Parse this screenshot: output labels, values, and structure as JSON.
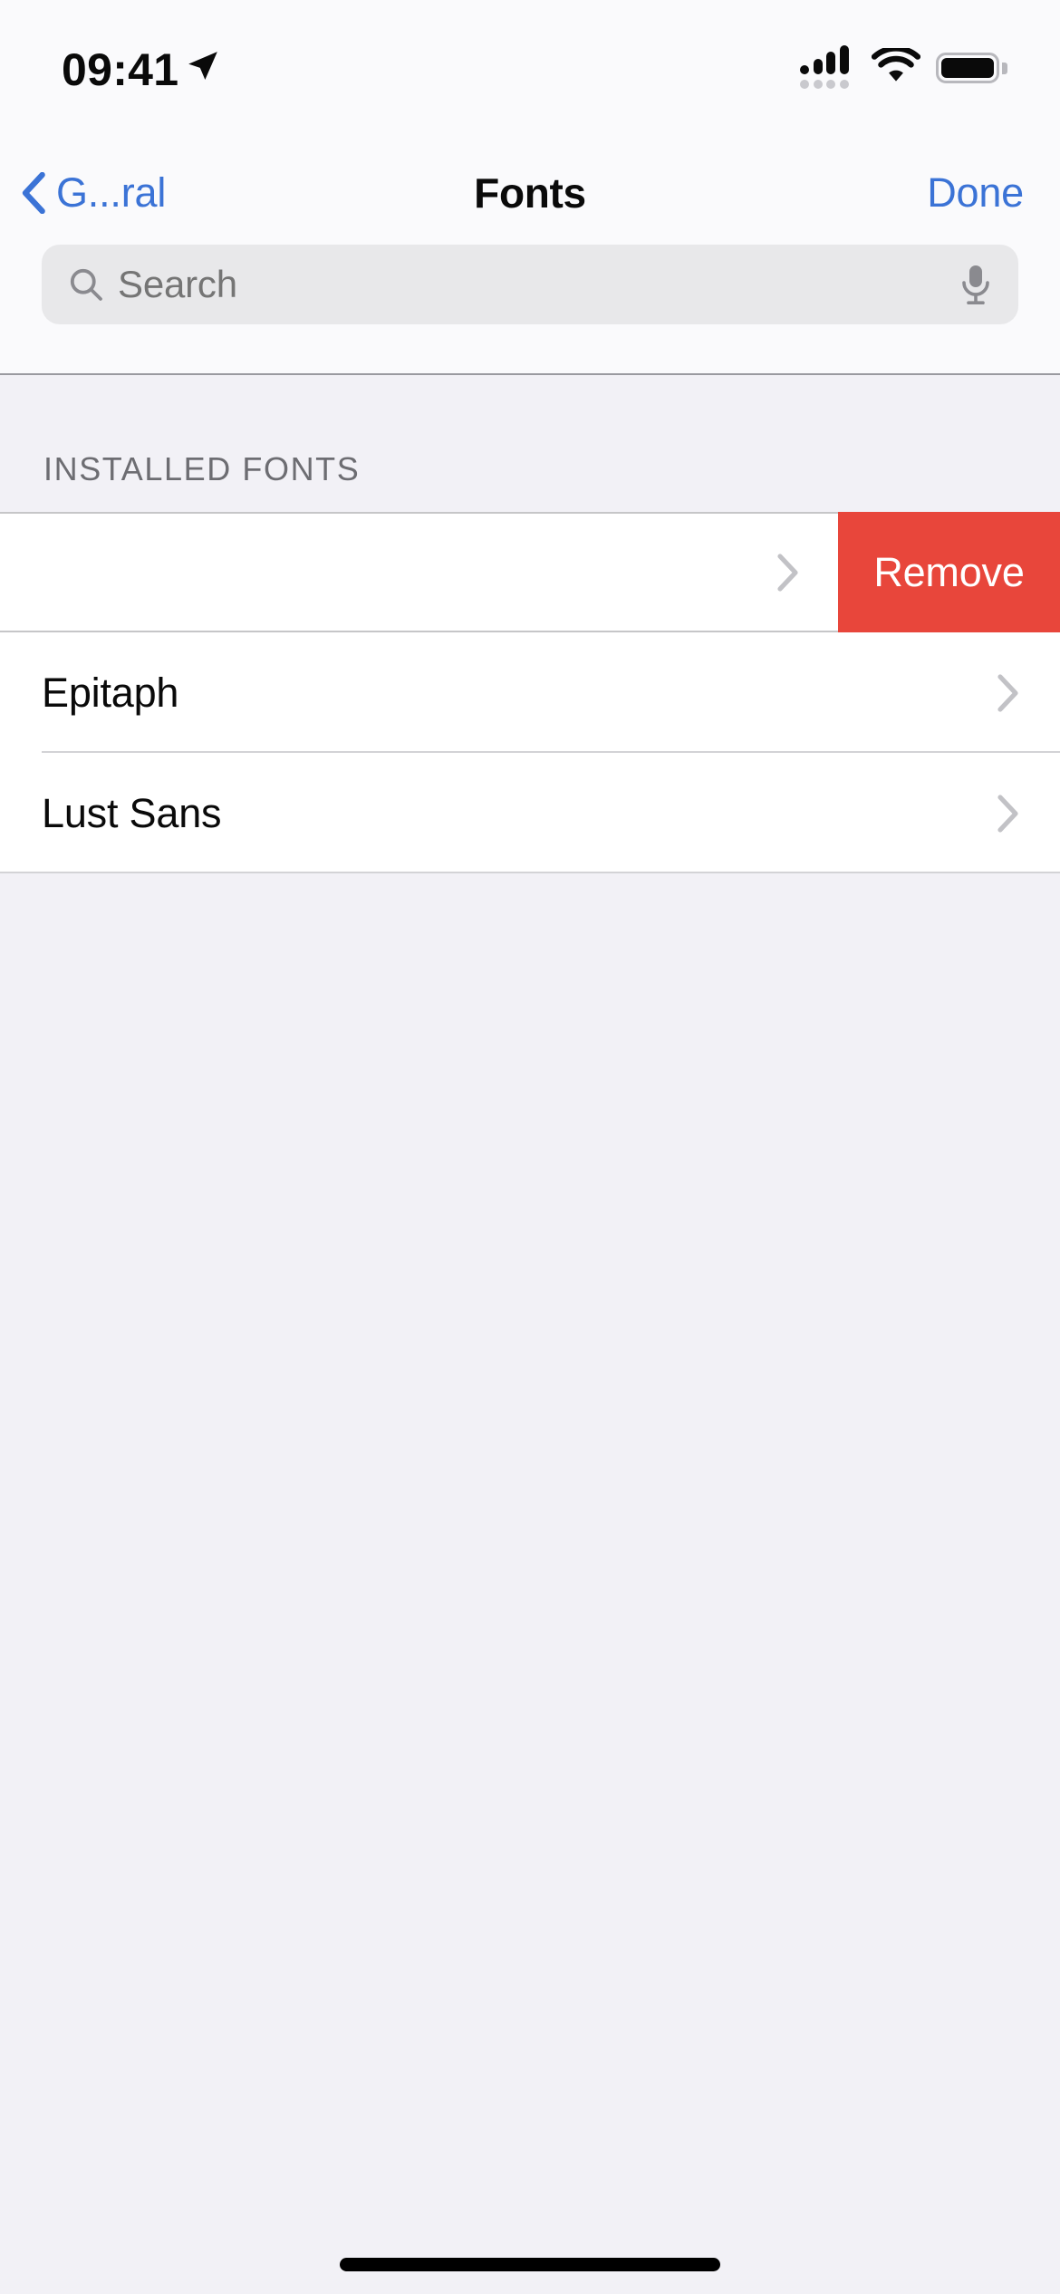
{
  "status_bar": {
    "time": "09:41",
    "location_icon": "location-arrow-icon",
    "cellular_icon": "cellular-signal-icon",
    "cellular_bars_filled": 4,
    "wifi_icon": "wifi-icon",
    "battery_icon": "battery-full-icon"
  },
  "nav_bar": {
    "back_label": "G...ral",
    "back_icon": "chevron-left-icon",
    "title": "Fonts",
    "done_label": "Done",
    "accent_color": "#3B73D6"
  },
  "search": {
    "placeholder": "Search",
    "value": "",
    "search_icon": "search-icon",
    "mic_icon": "microphone-icon"
  },
  "section": {
    "header": "INSTALLED FONTS"
  },
  "fonts": [
    {
      "name": "",
      "chevron": "chevron-right-icon",
      "swiped": true,
      "action_label": "Remove"
    },
    {
      "name": "Epitaph",
      "chevron": "chevron-right-icon",
      "swiped": false,
      "action_label": ""
    },
    {
      "name": "Lust Sans",
      "chevron": "chevron-right-icon",
      "swiped": false,
      "action_label": ""
    }
  ],
  "colors": {
    "destructive": "#E8463B",
    "page_background": "#F2F1F6",
    "row_background": "#FFFFFF",
    "search_background": "#E8E8EA"
  },
  "home_indicator": "home-indicator"
}
